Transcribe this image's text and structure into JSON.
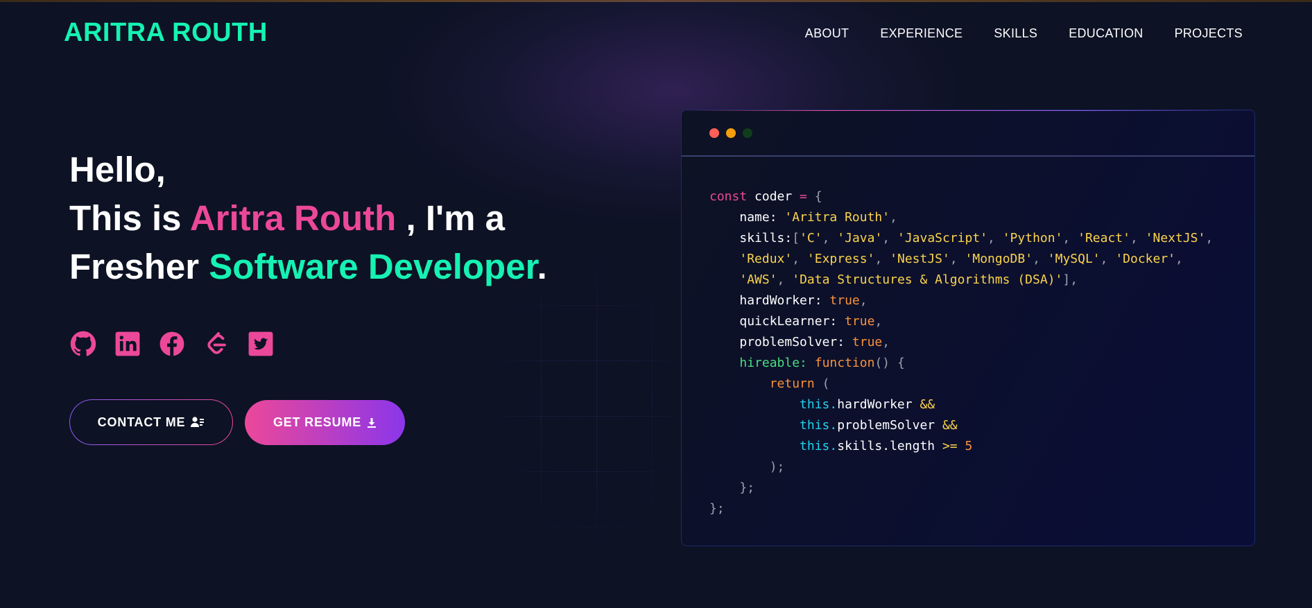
{
  "brand": {
    "name": "ARITRA ROUTH"
  },
  "nav": {
    "items": [
      "ABOUT",
      "EXPERIENCE",
      "SKILLS",
      "EDUCATION",
      "PROJECTS"
    ]
  },
  "hero": {
    "line1": "Hello,",
    "line2_prefix": "This is ",
    "name": "Aritra Routh",
    "line2_suffix": " , I'm a",
    "line3_prefix": "Fresher ",
    "role": "Software Developer",
    "line3_suffix": "."
  },
  "socials": [
    "github-icon",
    "linkedin-icon",
    "facebook-icon",
    "leetcode-icon",
    "twitter-icon"
  ],
  "buttons": {
    "contact": "CONTACT ME",
    "resume": "GET RESUME"
  },
  "colors": {
    "background": "#0d1224",
    "accent_green": "#16f2b3",
    "accent_pink": "#ec4899",
    "accent_violet": "#8b5cf6",
    "window_dot_red": "#ff5f56",
    "window_dot_yellow": "#ffbd2e",
    "window_dot_green": "#0f3d1c"
  },
  "code": {
    "l1": {
      "kw": "const",
      "name": " coder ",
      "op": "=",
      "brace": " {"
    },
    "l2": {
      "key": "name:",
      "str": "'Aritra Routh'",
      "end": ","
    },
    "skills_key": "skills:",
    "skills": [
      "'C'",
      "'Java'",
      "'JavaScript'",
      "'Python'",
      "'React'",
      "'NextJS'",
      "'Redux'",
      "'Express'",
      "'NestJS'",
      "'MongoDB'",
      "'MySQL'",
      "'Docker'",
      "'AWS'",
      "'Data Structures & Algorithms (DSA)'"
    ],
    "l6": {
      "key": "hardWorker:",
      "val": "true",
      "end": ","
    },
    "l7": {
      "key": "quickLearner:",
      "val": "true",
      "end": ","
    },
    "l8": {
      "key": "problemSolver:",
      "val": "true",
      "end": ","
    },
    "l9": {
      "key": "hireable:",
      "fn": "function",
      "rest": "() {"
    },
    "l10": {
      "kw": "return",
      "rest": " ("
    },
    "l11": {
      "this": "this.",
      "prop": "hardWorker",
      "op": " &&"
    },
    "l12": {
      "this": "this.",
      "prop": "problemSolver",
      "op": " &&"
    },
    "l13": {
      "this": "this.",
      "prop": "skills.length",
      "op": " >=",
      "num": " 5"
    },
    "l14": ");",
    "l15": "};",
    "l16": "};"
  }
}
